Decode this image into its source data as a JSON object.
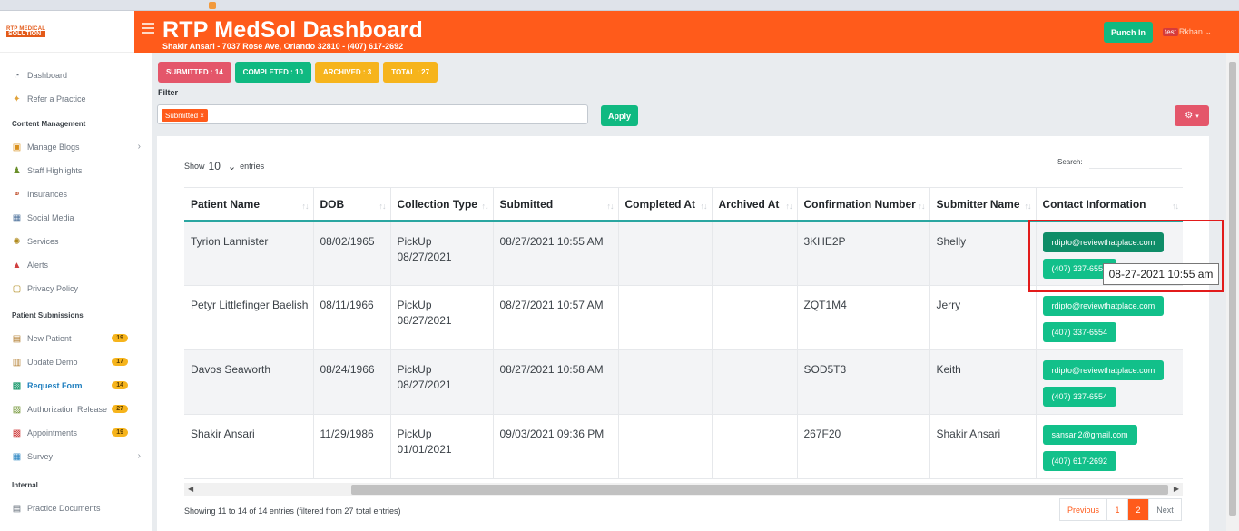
{
  "header": {
    "title": "RTP MedSol Dashboard",
    "subtitle": "Shakir Ansari - 7037 Rose Ave, Orlando 32810 - (407) 617-2692",
    "punch_label": "Punch In",
    "user_tag": "test",
    "user_name": "Rkhan"
  },
  "logo": {
    "top": "RTP MEDICAL",
    "bottom": "SOLUTION"
  },
  "sidebar": {
    "items_top": [
      {
        "label": "Dashboard",
        "icon": "dashboard-icon"
      },
      {
        "label": "Refer a Practice",
        "icon": "refer-icon"
      }
    ],
    "section_content": "Content Management",
    "items_content": [
      {
        "label": "Manage Blogs",
        "icon": "blog-icon"
      },
      {
        "label": "Staff Highlights",
        "icon": "staff-icon"
      },
      {
        "label": "Insurances",
        "icon": "insurance-icon"
      },
      {
        "label": "Social Media",
        "icon": "social-icon"
      },
      {
        "label": "Services",
        "icon": "services-icon"
      },
      {
        "label": "Alerts",
        "icon": "alerts-icon"
      },
      {
        "label": "Privacy Policy",
        "icon": "privacy-icon"
      }
    ],
    "section_patient": "Patient Submissions",
    "items_patient": [
      {
        "label": "New Patient",
        "badge": "19"
      },
      {
        "label": "Update Demo",
        "badge": "17"
      },
      {
        "label": "Request Form",
        "badge": "14"
      },
      {
        "label": "Authorization Release",
        "badge": "27"
      },
      {
        "label": "Appointments",
        "badge": "19"
      },
      {
        "label": "Survey"
      }
    ],
    "section_internal": "Internal",
    "items_internal": [
      {
        "label": "Practice Documents"
      }
    ]
  },
  "stats": {
    "submitted": "SUBMITTED : 14",
    "completed": "COMPLETED : 10",
    "archived": "ARCHIVED : 3",
    "total": "TOTAL : 27"
  },
  "colors": {
    "accent": "#ff5b1b",
    "submitted": "#e4566a",
    "completed": "#10b981",
    "archived": "#f6b41c",
    "total": "#f6b41c"
  },
  "filter": {
    "label": "Filter",
    "chip": "Submitted ×",
    "apply_label": "Apply"
  },
  "table_controls": {
    "show_label": "Show",
    "page_size": "10",
    "entries_label": "entries",
    "search_label": "Search:",
    "search_value": ""
  },
  "table": {
    "columns": [
      "Patient Name",
      "DOB",
      "Collection Type",
      "Submitted",
      "Completed At",
      "Archived At",
      "Confirmation Number",
      "Submitter Name",
      "Contact Information"
    ],
    "rows": [
      {
        "name": "Tyrion Lannister",
        "dob": "08/02/1965",
        "type": "PickUp",
        "type_date": "08/27/2021",
        "submitted": "08/27/2021 10:55 AM",
        "completed": "",
        "archived": "",
        "conf": "3KHE2P",
        "submitter": "Shelly",
        "email": "rdipto@reviewthatplace.com",
        "phone": "(407) 337-6554"
      },
      {
        "name": "Petyr Littlefinger Baelish",
        "dob": "08/11/1966",
        "type": "PickUp",
        "type_date": "08/27/2021",
        "submitted": "08/27/2021 10:57 AM",
        "completed": "",
        "archived": "",
        "conf": "ZQT1M4",
        "submitter": "Jerry",
        "email": "rdipto@reviewthatplace.com",
        "phone": "(407) 337-6554"
      },
      {
        "name": "Davos Seaworth",
        "dob": "08/24/1966",
        "type": "PickUp",
        "type_date": "08/27/2021",
        "submitted": "08/27/2021 10:58 AM",
        "completed": "",
        "archived": "",
        "conf": "SOD5T3",
        "submitter": "Keith",
        "email": "rdipto@reviewthatplace.com",
        "phone": "(407) 337-6554"
      },
      {
        "name": "Shakir Ansari",
        "dob": "11/29/1986",
        "type": "PickUp",
        "type_date": "01/01/2021",
        "submitted": "09/03/2021 09:36 PM",
        "completed": "",
        "archived": "",
        "conf": "267F20",
        "submitter": "Shakir Ansari",
        "email": "sansari2@gmail.com",
        "phone": "(407) 617-2692"
      }
    ]
  },
  "tooltip": "08-27-2021 10:55 am",
  "footer": {
    "info": "Showing 11 to 14 of 14 entries (filtered from 27 total entries)",
    "prev": "Previous",
    "page1": "1",
    "page2": "2",
    "next": "Next"
  }
}
